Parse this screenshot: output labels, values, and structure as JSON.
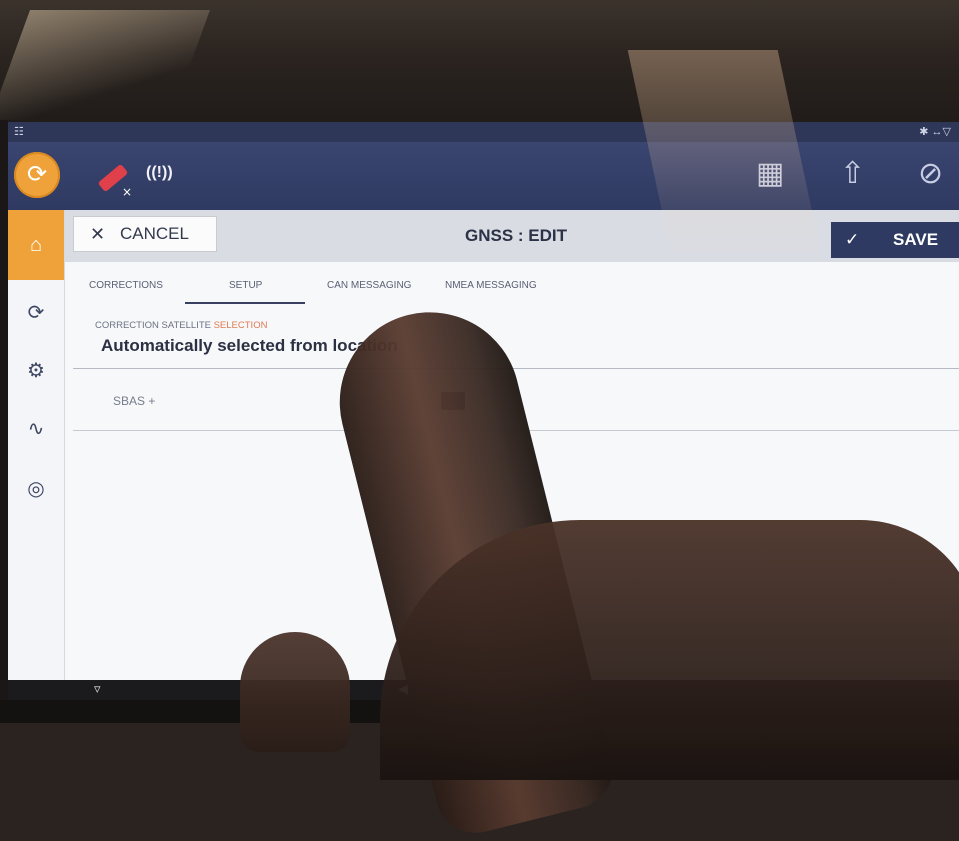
{
  "header": {
    "cancel_label": "CANCEL",
    "title": "GNSS : EDIT",
    "save_label": "SAVE"
  },
  "tabs": [
    {
      "label": "CORRECTIONS"
    },
    {
      "label": "SETUP",
      "active": true
    },
    {
      "label": "CAN MESSAGING"
    },
    {
      "label": "NMEA MESSAGING"
    }
  ],
  "setup": {
    "correction_label_main": "CORRECTION SATELLITE ",
    "correction_label_accent": "SELECTION",
    "correction_value": "Automatically selected from location",
    "sbas_label": "SBAS +"
  },
  "icons": {
    "home": "home-icon",
    "run": "running-person-icon",
    "satellite": "satellite-icon",
    "signal": "signal-icon",
    "implement": "implement-icon",
    "upload": "upload-icon",
    "steering": "steering-disabled-icon",
    "settings": "settings-icon",
    "diagnostics": "pulse-icon",
    "utilities": "ut-icon",
    "menu": "menu-icon",
    "back": "back-icon"
  },
  "colors": {
    "accent": "#f0a23a",
    "topbar": "#2f3a62",
    "selection_accent": "#e07a52"
  }
}
